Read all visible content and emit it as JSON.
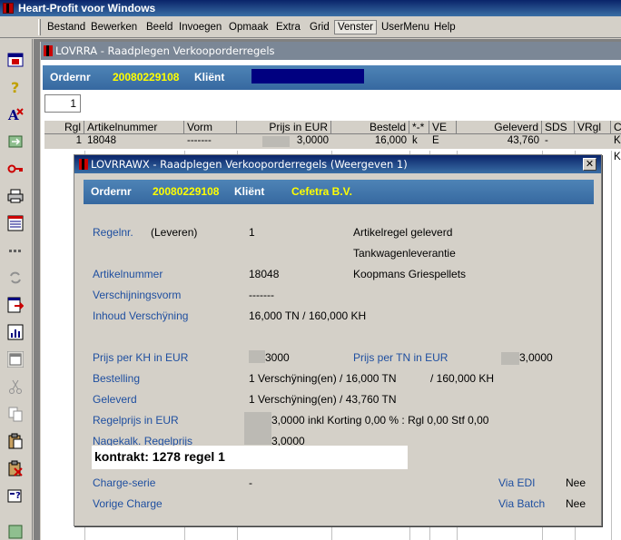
{
  "app": {
    "title": "Heart-Profit voor Windows"
  },
  "menu": [
    "Bestand",
    "Bewerken",
    "Beeld",
    "Invoegen",
    "Opmaak",
    "Extra",
    "Grid",
    "Venster",
    "UserMenu",
    "Help"
  ],
  "toolbar_icons": [
    "window-icon",
    "question-icon",
    "spellcheck-icon",
    "refresh-icon",
    "key-icon",
    "print-icon",
    "form-icon",
    "dots-icon",
    "sync-icon",
    "export-icon",
    "chart-icon",
    "window-frame-icon",
    "cut-icon",
    "copy-icon",
    "paste-icon",
    "paste-special-icon",
    "settings-icon",
    "exit-icon"
  ],
  "main_window": {
    "title": "LOVRRA - Raadplegen Verkooporderregels",
    "order_label": "Ordernr",
    "order_number": "20080229108",
    "client_label": "Kliënt",
    "page": "1",
    "columns": [
      "Rgl",
      "Artikelnummer",
      "Vorm",
      "Prijs in EUR",
      "Besteld",
      "*-*",
      "VE",
      "Geleverd",
      "SDS",
      "VRgl",
      "C"
    ],
    "row": {
      "rgl": "1",
      "artikel": "18048",
      "vorm": "-------",
      "prijs": "3,0000",
      "besteld": "16,000",
      "flag": "k",
      "ve": "E",
      "geleverd": "43,760",
      "sds": "-",
      "c1": "Ko",
      "c2": "Ko"
    }
  },
  "dialog": {
    "title": "LOVRRAWX - Raadplegen Verkooporderregels (Weergeven 1)",
    "order_label": "Ordernr",
    "order_number": "20080229108",
    "client_label": "Kliënt",
    "client_name": "Cefetra  B.V.",
    "regelnr_label": "Regelnr.",
    "regelnr_mode": "(Leveren)",
    "regelnr_value": "1",
    "status1": "Artikelregel geleverd",
    "status2": "Tankwagenleverantie",
    "artikel_label": "Artikelnummer",
    "artikel_value": "18048",
    "artikel_name": "Koopmans Griespellets",
    "vorm_label": "Verschijningsvorm",
    "vorm_value": "-------",
    "inhoud_label": "Inhoud Verschÿning",
    "inhoud_value": "16,000 TN  / 160,000 KH",
    "prijs_kh_label": "Prijs per KH  in EUR",
    "prijs_kh_value": "3000",
    "prijs_tn_label": "Prijs per TN in EUR",
    "prijs_tn_value": "3,0000",
    "bestelling_label": "Bestelling",
    "bestelling_value": "1 Verschÿning(en) / 16,000 TN",
    "bestelling_kh": "/ 160,000 KH",
    "geleverd_label": "Geleverd",
    "geleverd_value": "1 Verschÿning(en) / 43,760 TN",
    "regelprijs_label": "Regelprijs in EUR",
    "regelprijs_value": "3,0000 inkl Korting 0,00 % : Rgl 0,00 Stf 0,00",
    "nagekalk_label": "Nagekalk. Regelprijs",
    "nagekalk_value": "3,0000",
    "contract": "kontrakt: 1278 regel 1",
    "charge_label": "Charge-serie",
    "charge_value": "-",
    "vorige_label": "Vorige Charge",
    "edi_label": "Via EDI",
    "edi_value": "Nee",
    "batch_label": "Via Batch",
    "batch_value": "Nee"
  }
}
